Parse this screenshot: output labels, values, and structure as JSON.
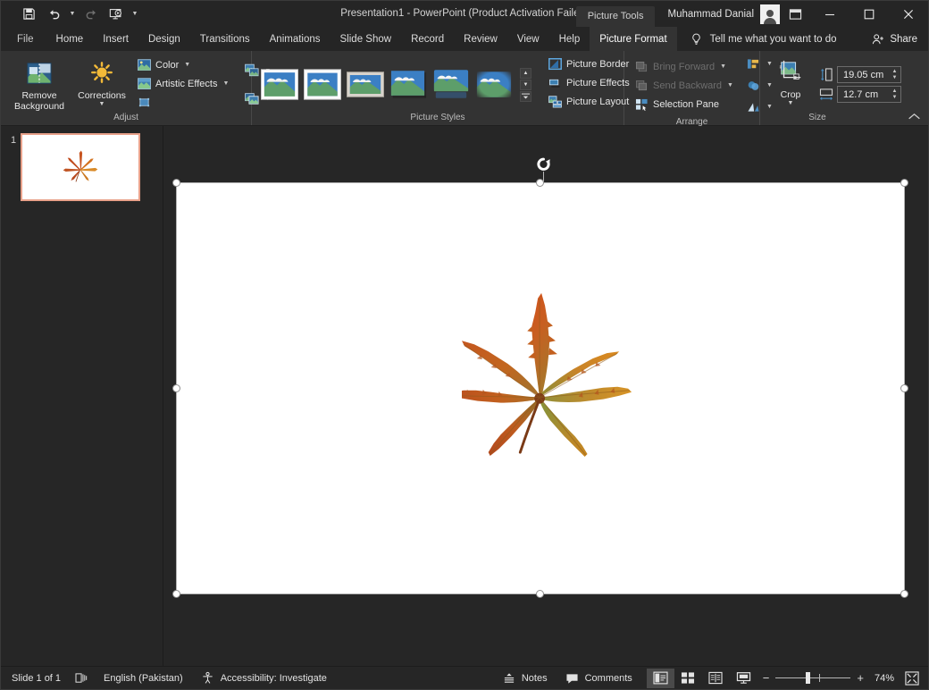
{
  "app": {
    "title": "Presentation1  -  PowerPoint (Product Activation Failed)",
    "contextual_tab_group": "Picture Tools",
    "account_name": "Muhammad Danial"
  },
  "quick_access": {
    "save": "Save",
    "undo": "Undo",
    "redo": "Redo",
    "start_presentation": "Start From Beginning",
    "customize": "Customize Quick Access Toolbar"
  },
  "window_controls": {
    "ribbon_display": "Ribbon Display Options",
    "minimize": "—",
    "maximize": "☐",
    "close": "✕"
  },
  "tabs": [
    {
      "label": "File",
      "active": false
    },
    {
      "label": "Home",
      "active": false
    },
    {
      "label": "Insert",
      "active": false
    },
    {
      "label": "Design",
      "active": false
    },
    {
      "label": "Transitions",
      "active": false
    },
    {
      "label": "Animations",
      "active": false
    },
    {
      "label": "Slide Show",
      "active": false
    },
    {
      "label": "Record",
      "active": false
    },
    {
      "label": "Review",
      "active": false
    },
    {
      "label": "View",
      "active": false
    },
    {
      "label": "Help",
      "active": false
    },
    {
      "label": "Picture Format",
      "active": true
    }
  ],
  "tell_me": {
    "placeholder": "Tell me what you want to do"
  },
  "share": {
    "label": "Share"
  },
  "ribbon": {
    "groups": [
      {
        "name": "Adjust",
        "label": "Adjust",
        "remove_background": "Remove\nBackground",
        "remove_background_line1": "Remove",
        "remove_background_line2": "Background",
        "corrections": "Corrections",
        "color": "Color",
        "artistic_effects": "Artistic Effects",
        "compress_pictures": "Compress Pictures",
        "change_picture": "Change Picture",
        "reset_picture": "Reset Picture",
        "transparency": "Transparency"
      },
      {
        "name": "Picture Styles",
        "label": "Picture Styles",
        "styles": [
          "Simple Frame, White",
          "Beveled Matte, White",
          "Metal Frame",
          "Drop Shadow Rectangle",
          "Reflected Rounded Rectangle",
          "Soft Edge Rectangle"
        ],
        "scroll_up": "Scroll Up",
        "scroll_down": "Scroll Down",
        "more": "More",
        "picture_border": "Picture Border",
        "picture_effects": "Picture Effects",
        "picture_layout": "Picture Layout",
        "dialog_launcher": "Format Picture"
      },
      {
        "name": "Arrange",
        "label": "Arrange",
        "bring_forward": "Bring Forward",
        "send_backward": "Send Backward",
        "selection_pane": "Selection Pane",
        "align": "Align",
        "group": "Group",
        "rotate": "Rotate"
      },
      {
        "name": "Size",
        "label": "Size",
        "crop": "Crop",
        "height_value": "19.05 cm",
        "width_value": "12.7 cm",
        "height_label": "Shape Height",
        "width_label": "Shape Width",
        "dialog_launcher": "Size and Position"
      }
    ],
    "collapse": "Collapse the Ribbon"
  },
  "thumbnails": {
    "slides": [
      {
        "number": "1",
        "selected": true
      }
    ]
  },
  "slide_canvas": {
    "picture_name": "maple-leaf-picture",
    "selected": true,
    "rotate_handle": "Rotate"
  },
  "status_bar": {
    "slide_count": "Slide 1 of 1",
    "accessibility_checker_icon": "slide-notes-icon",
    "language": "English (Pakistan)",
    "accessibility": "Accessibility: Investigate",
    "notes": "Notes",
    "comments": "Comments",
    "views": [
      {
        "name": "normal-view",
        "label": "Normal",
        "active": true
      },
      {
        "name": "slide-sorter-view",
        "label": "Slide Sorter",
        "active": false
      },
      {
        "name": "reading-view",
        "label": "Reading View",
        "active": false
      },
      {
        "name": "slide-show-view",
        "label": "Slide Show",
        "active": false
      }
    ],
    "zoom_out": "−",
    "zoom_in": "+",
    "zoom_level": "74%",
    "fit_to_window": "Fit slide to current window"
  },
  "colors": {
    "chrome": "#252525",
    "ribbon": "#333333",
    "workspace": "#262626",
    "slide": "#ffffff",
    "thumb_selected_border": "#e8a18a",
    "text": "#e6e6e6"
  }
}
